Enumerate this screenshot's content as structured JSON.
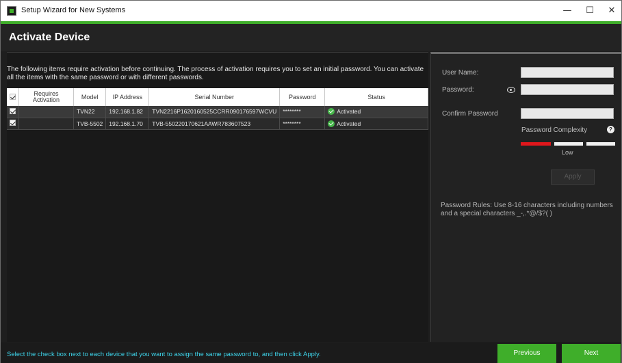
{
  "window": {
    "title": "Setup Wizard for New Systems"
  },
  "controls": {
    "minimize": "—",
    "maximize": "☐",
    "close": "✕"
  },
  "page": {
    "title": "Activate Device"
  },
  "instructions": "The following items require activation before continuing.  The process of activation requires you to set an initial password.  You can activate all the items with the same password or with different passwords.",
  "table": {
    "headers": [
      "Requires Activation",
      "Model",
      "IP Address",
      "Serial Number",
      "Password",
      "Status"
    ],
    "rows": [
      {
        "checked": true,
        "model": "TVN22",
        "ip": "192.168.1.82",
        "serial": "TVN2216P1620160525CCRR090176597WCVU",
        "password": "********",
        "status": "Activated"
      },
      {
        "checked": true,
        "model": "TVB-5502",
        "ip": "192.168.1.70",
        "serial": "TVB-550220170621AAWR783607523",
        "password": "********",
        "status": "Activated"
      }
    ]
  },
  "form": {
    "username_label": "User Name:",
    "password_label": "Password:",
    "confirm_label": "Confirm Password",
    "complexity_label": "Password Complexity",
    "complexity_value": "Low",
    "help": "?",
    "apply": "Apply",
    "rules": "Password Rules: Use 8-16 characters including numbers and a special characters _-,.*@/$?( )"
  },
  "colors": {
    "accent": "#3fae2a",
    "complexity_low": "#e0171c",
    "footer_text": "#3dd2e8"
  },
  "footer": {
    "hint": "Select the check box next to each device that you want to assign the same password to, and then click Apply."
  },
  "buttons": {
    "previous": "Previous",
    "next": "Next"
  }
}
